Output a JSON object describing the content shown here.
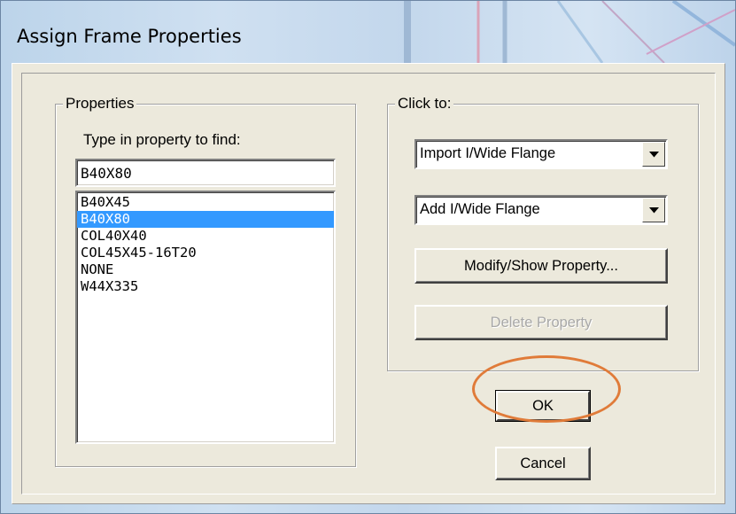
{
  "window": {
    "title": "Assign Frame Properties"
  },
  "properties_group": {
    "legend": "Properties",
    "find_label": "Type in property to find:",
    "find_value": "B40X80",
    "items": [
      {
        "label": "B40X45",
        "selected": false
      },
      {
        "label": "B40X80",
        "selected": true
      },
      {
        "label": "COL40X40",
        "selected": false
      },
      {
        "label": "COL45X45-16T20",
        "selected": false
      },
      {
        "label": "NONE",
        "selected": false
      },
      {
        "label": "W44X335",
        "selected": false
      }
    ]
  },
  "click_to_group": {
    "legend": "Click to:",
    "import_combo": "Import I/Wide Flange",
    "add_combo": "Add I/Wide Flange",
    "modify_button": "Modify/Show Property...",
    "delete_button": "Delete Property"
  },
  "buttons": {
    "ok": "OK",
    "cancel": "Cancel"
  },
  "colors": {
    "highlight_annotation": "#e07b39",
    "selection": "#3399ff",
    "dialog_face": "#ece9dc"
  }
}
